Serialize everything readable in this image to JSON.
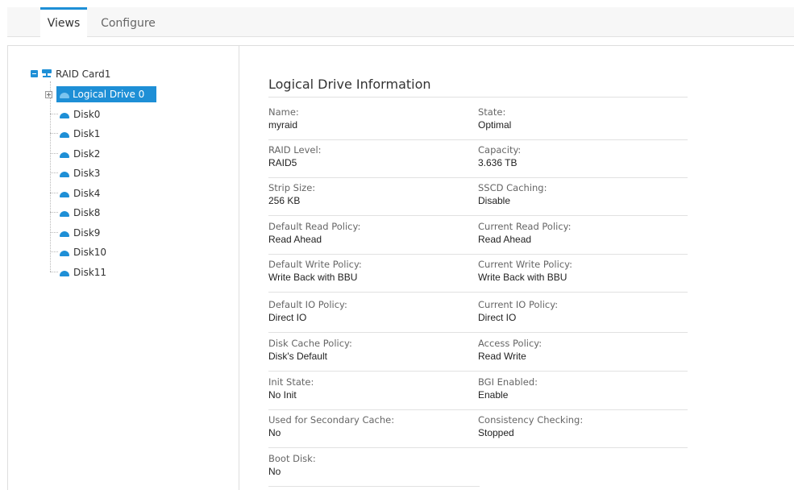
{
  "tabs": [
    {
      "label": "Views",
      "active": true
    },
    {
      "label": "Configure",
      "active": false
    }
  ],
  "tree": {
    "root_label": "RAID Card1",
    "logical_drive_label": "Logical Drive 0",
    "disks": [
      "Disk0",
      "Disk1",
      "Disk2",
      "Disk3",
      "Disk4",
      "Disk8",
      "Disk9",
      "Disk10",
      "Disk11"
    ]
  },
  "info": {
    "title": "Logical Drive Information",
    "fields": [
      {
        "label": "Name:",
        "value": "myraid"
      },
      {
        "label": "State:",
        "value": "Optimal"
      },
      {
        "label": "RAID Level:",
        "value": "RAID5"
      },
      {
        "label": "Capacity:",
        "value": "3.636 TB"
      },
      {
        "label": "Strip Size:",
        "value": "256 KB"
      },
      {
        "label": "SSCD Caching:",
        "value": "Disable"
      },
      {
        "label": "Default Read Policy:",
        "value": "Read Ahead"
      },
      {
        "label": "Current Read Policy:",
        "value": "Read Ahead"
      },
      {
        "label": "Default Write Policy:",
        "value": "Write Back with BBU"
      },
      {
        "label": "Current Write Policy:",
        "value": "Write Back with BBU"
      },
      {
        "label": "Default IO Policy:",
        "value": "Direct IO"
      },
      {
        "label": "Current IO Policy:",
        "value": "Direct IO"
      },
      {
        "label": "Disk Cache Policy:",
        "value": "Disk's Default"
      },
      {
        "label": "Access Policy:",
        "value": "Read Write"
      },
      {
        "label": "Init State:",
        "value": "No Init"
      },
      {
        "label": "BGI Enabled:",
        "value": "Enable"
      },
      {
        "label": "Used for Secondary Cache:",
        "value": "No"
      },
      {
        "label": "Consistency Checking:",
        "value": "Stopped"
      },
      {
        "label": "Boot Disk:",
        "value": "No"
      }
    ]
  },
  "colors": {
    "accent": "#1e8fd6"
  }
}
